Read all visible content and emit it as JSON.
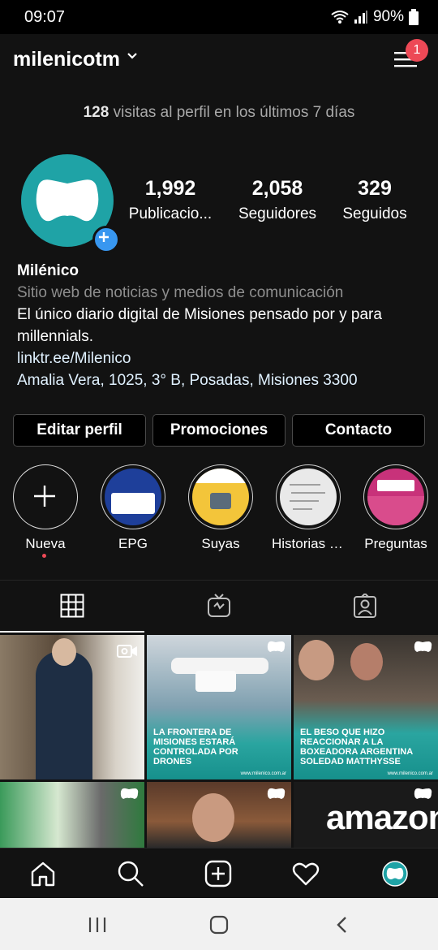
{
  "status": {
    "time": "09:07",
    "battery": "90%"
  },
  "header": {
    "username": "milenicotm",
    "notifications": "1"
  },
  "insights": {
    "count": "128",
    "text": " visitas al perfil en los últimos 7 días"
  },
  "stats": [
    {
      "value": "1,992",
      "label": "Publicacio..."
    },
    {
      "value": "2,058",
      "label": "Seguidores"
    },
    {
      "value": "329",
      "label": "Seguidos"
    }
  ],
  "bio": {
    "name": "Milénico",
    "category": "Sitio web de noticias y medios de comunicación",
    "description": "El único diario digital de Misiones pensado por y para millennials.",
    "link": "linktr.ee/Milenico",
    "address": "Amalia Vera, 1025, 3° B, Posadas, Misiones 3300"
  },
  "buttons": {
    "edit": "Editar perfil",
    "promotions": "Promociones",
    "contact": "Contacto"
  },
  "highlights": [
    {
      "label": "Nueva"
    },
    {
      "label": "EPG"
    },
    {
      "label": "Suyas"
    },
    {
      "label": "Historias d..."
    },
    {
      "label": "Preguntas"
    }
  ],
  "posts": [
    {
      "caption": ""
    },
    {
      "caption": "La frontera de Misiones estará controlada por drones",
      "footer": "www.milenico.com.ar"
    },
    {
      "caption": "El beso que hizo reaccionar a la boxeadora argentina Soledad Matthysse",
      "footer": "www.milenico.com.ar"
    },
    {
      "caption": ""
    },
    {
      "caption": ""
    },
    {
      "caption": "amazon"
    }
  ],
  "colors": {
    "accent": "#3897f0",
    "badge": "#ed4956",
    "brand": "#1fa3a6"
  }
}
